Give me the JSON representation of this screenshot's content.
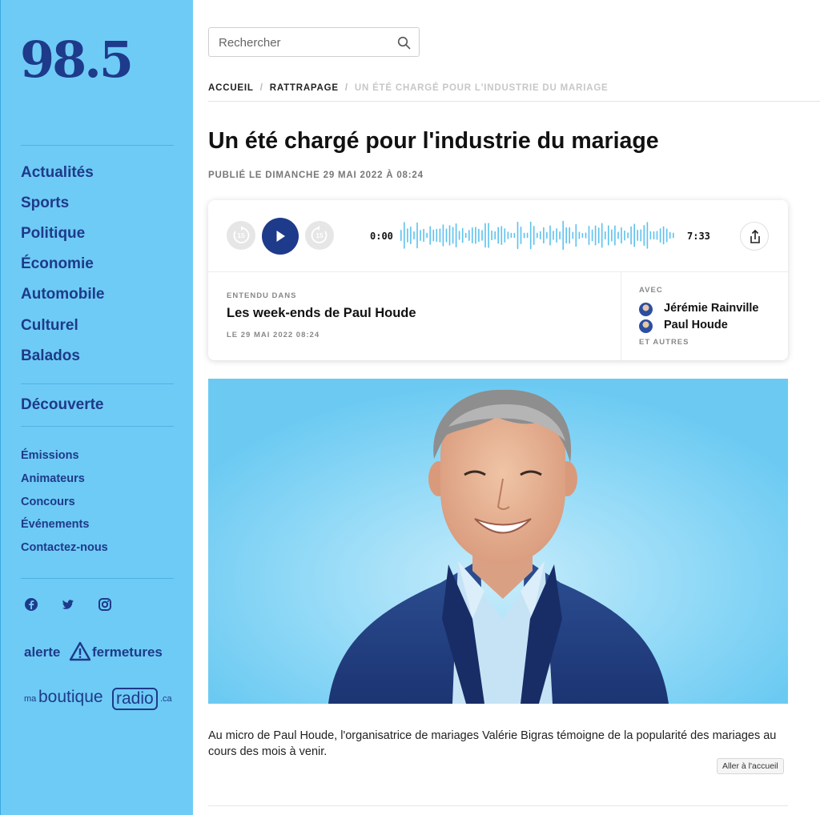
{
  "sidebar": {
    "logo": "98.5",
    "main_nav": [
      "Actualités",
      "Sports",
      "Politique",
      "Économie",
      "Automobile",
      "Culturel",
      "Balados"
    ],
    "discover": "Découverte",
    "secondary_nav": [
      "Émissions",
      "Animateurs",
      "Concours",
      "Événements",
      "Contactez-nous"
    ],
    "social_icons": [
      "facebook-icon",
      "twitter-icon",
      "instagram-icon"
    ],
    "alerte": {
      "left": "alerte",
      "right": "fermetures"
    },
    "boutique": {
      "prefix": "ma",
      "word1": "boutique",
      "word2": "radio",
      "suffix": ".ca"
    }
  },
  "search": {
    "placeholder": "Rechercher",
    "value": ""
  },
  "breadcrumb": {
    "home": "ACCUEIL",
    "section": "RATTRAPAGE",
    "current": "UN ÉTÉ CHARGÉ POUR L'INDUSTRIE DU MARIAGE",
    "separator": "/"
  },
  "article": {
    "title": "Un été chargé pour l'industrie du mariage",
    "published": "PUBLIÉ LE DIMANCHE 29 MAI 2022 À 08:24",
    "caption": "Au micro de Paul Houde, l'organisatrice de mariages Valérie Bigras témoigne de la popularité des mariages au cours des mois à venir."
  },
  "player": {
    "rewind_label": "15",
    "forward_label": "15",
    "current_time": "0:00",
    "total_time": "7:33",
    "heard_in_label": "ENTENDU DANS",
    "show_name": "Les week-ends de Paul Houde",
    "show_date": "LE 29 MAI 2022 08:24",
    "with_label": "AVEC",
    "hosts": [
      "Jérémie Rainville",
      "Paul Houde"
    ],
    "others_label": "ET AUTRES"
  },
  "tooltip": "Aller à l'accueil",
  "colors": {
    "brand": "#1e3a8a",
    "sidebar": "#6ecbf5",
    "wave": "#5cc2ef"
  }
}
